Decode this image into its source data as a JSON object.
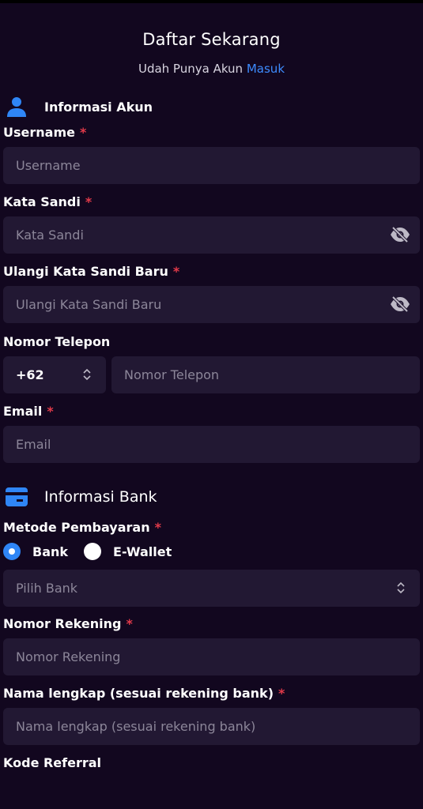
{
  "header": {
    "title": "Daftar Sekarang",
    "login_prompt": "Udah Punya Akun",
    "login_link": "Masuk"
  },
  "colors": {
    "background": "#12071f",
    "input_bg": "#221833",
    "accent": "#3d8bfd",
    "required": "#e23a4a"
  },
  "account_section": {
    "title": "Informasi Akun",
    "icon": "user-icon",
    "username": {
      "label": "Username",
      "required": "*",
      "placeholder": "Username"
    },
    "password": {
      "label": "Kata Sandi",
      "required": "*",
      "placeholder": "Kata Sandi"
    },
    "confirm_password": {
      "label": "Ulangi Kata Sandi Baru",
      "required": "*",
      "placeholder": "Ulangi Kata Sandi Baru"
    },
    "phone": {
      "label": "Nomor Telepon",
      "code": "+62",
      "placeholder": "Nomor Telepon"
    },
    "email": {
      "label": "Email",
      "required": "*",
      "placeholder": "Email"
    }
  },
  "bank_section": {
    "title": "Informasi Bank",
    "icon": "card-icon",
    "payment_method": {
      "label": "Metode Pembayaran",
      "required": "*",
      "options": [
        "Bank",
        "E-Wallet"
      ],
      "selected": "Bank"
    },
    "bank_select": {
      "placeholder": "Pilih Bank"
    },
    "account_number": {
      "label": "Nomor Rekening",
      "required": "*",
      "placeholder": "Nomor Rekening"
    },
    "full_name": {
      "label": "Nama lengkap (sesuai rekening bank)",
      "required": "*",
      "placeholder": "Nama lengkap (sesuai rekening bank)"
    },
    "referral": {
      "label": "Kode Referral"
    }
  }
}
